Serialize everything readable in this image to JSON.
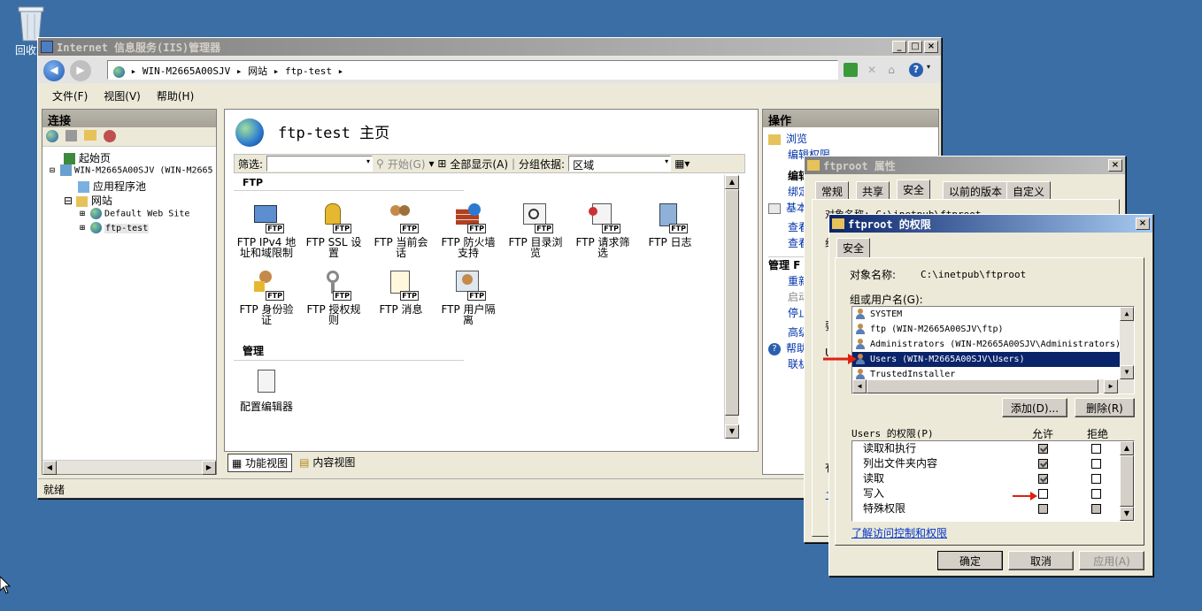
{
  "desktop": {
    "recycle_label": "回收站"
  },
  "iis": {
    "title": "Internet 信息服务(IIS)管理器",
    "address": [
      "WIN-M2665A00SJV",
      "网站",
      "ftp-test"
    ],
    "menu": [
      "文件(F)",
      "视图(V)",
      "帮助(H)"
    ],
    "connections": {
      "header": "连接",
      "tree": [
        {
          "label": "起始页"
        },
        {
          "label": "WIN-M2665A00SJV (WIN-M2665"
        },
        {
          "label": "应用程序池"
        },
        {
          "label": "网站"
        },
        {
          "label": "Default Web Site"
        },
        {
          "label": "ftp-test"
        }
      ]
    },
    "main": {
      "title": "ftp-test 主页",
      "filter_label": "筛选:",
      "start_label": "开始(G)",
      "show_all_label": "全部显示(A)",
      "group_label": "分组依据:",
      "group_value": "区域",
      "ftp_section": "FTP",
      "manage_section": "管理",
      "features": [
        {
          "icon": "ip-restriction-icon",
          "line1": "FTP IPv4 地",
          "line2": "址和域限制"
        },
        {
          "icon": "ssl-settings-icon",
          "line1": "FTP SSL 设",
          "line2": "置"
        },
        {
          "icon": "current-sessions-icon",
          "line1": "FTP 当前会",
          "line2": "话"
        },
        {
          "icon": "firewall-icon",
          "line1": "FTP 防火墙",
          "line2": "支持"
        },
        {
          "icon": "directory-browsing-icon",
          "line1": "FTP 目录浏",
          "line2": "览"
        },
        {
          "icon": "request-filtering-icon",
          "line1": "FTP 请求筛",
          "line2": "选"
        },
        {
          "icon": "logging-icon",
          "line1": "FTP 日志",
          "line2": ""
        },
        {
          "icon": "authentication-icon",
          "line1": "FTP 身份验",
          "line2": "证"
        },
        {
          "icon": "authorization-icon",
          "line1": "FTP 授权规",
          "line2": "则"
        },
        {
          "icon": "messages-icon",
          "line1": "FTP 消息",
          "line2": ""
        },
        {
          "icon": "user-isolation-icon",
          "line1": "FTP 用户隔",
          "line2": "离"
        }
      ],
      "config_editor": "配置编辑器"
    },
    "view_tabs": [
      "功能视图",
      "内容视图"
    ],
    "status": "就绪",
    "actions": {
      "header": "操作",
      "items": [
        "浏览",
        "编辑权限",
        "编辑",
        "绑定",
        "基本",
        "查看",
        "查看",
        "管理 F",
        "重新",
        "启动",
        "停止",
        "高级",
        "帮助",
        "联机"
      ]
    }
  },
  "props": {
    "title": "ftproot 属性",
    "tabs": [
      "常规",
      "共享",
      "安全",
      "以前的版本",
      "自定义"
    ],
    "object_peek": "对象名称:   C:\\inetpub\\ftproot",
    "peek_chars": [
      "组",
      "要",
      "U",
      "有",
      "二"
    ]
  },
  "perm": {
    "title": "ftproot 的权限",
    "tab": "安全",
    "object_label": "对象名称:",
    "object_value": "C:\\inetpub\\ftproot",
    "group_label": "组或用户名(G):",
    "users": [
      "SYSTEM",
      "ftp (WIN-M2665A00SJV\\ftp)",
      "Administrators (WIN-M2665A00SJV\\Administrators)",
      "Users (WIN-M2665A00SJV\\Users)",
      "TrustedInstaller"
    ],
    "selected_user_index": 3,
    "add_button": "添加(D)...",
    "remove_button": "删除(R)",
    "perm_for_label": "Users 的权限(P)",
    "allow_label": "允许",
    "deny_label": "拒绝",
    "permissions": [
      {
        "name": "读取和执行",
        "allow": "checked",
        "deny": "empty"
      },
      {
        "name": "列出文件夹内容",
        "allow": "checked",
        "deny": "empty"
      },
      {
        "name": "读取",
        "allow": "checked",
        "deny": "empty"
      },
      {
        "name": "写入",
        "allow": "empty",
        "deny": "empty"
      },
      {
        "name": "特殊权限",
        "allow": "grey",
        "deny": "grey"
      }
    ],
    "link": "了解访问控制和权限",
    "ok": "确定",
    "cancel": "取消",
    "apply": "应用(A)"
  }
}
